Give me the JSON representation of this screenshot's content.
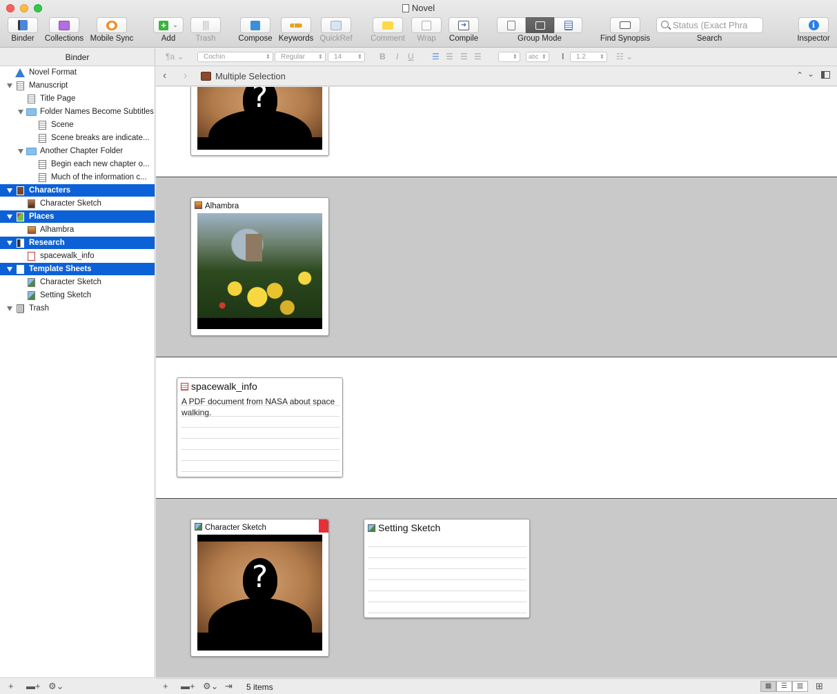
{
  "window": {
    "title": "Novel"
  },
  "toolbar": {
    "binder": "Binder",
    "collections": "Collections",
    "mobile_sync": "Mobile Sync",
    "add": "Add",
    "trash": "Trash",
    "compose": "Compose",
    "keywords": "Keywords",
    "quickref": "QuickRef",
    "comment": "Comment",
    "wrap": "Wrap",
    "compile": "Compile",
    "group_mode": "Group Mode",
    "find_synopsis": "Find Synopsis",
    "search_placeholder": "Status (Exact Phra",
    "search": "Search",
    "inspector": "Inspector"
  },
  "binder": {
    "header": "Binder",
    "items": [
      {
        "label": "Novel Format"
      },
      {
        "label": "Manuscript"
      },
      {
        "label": "Title Page"
      },
      {
        "label": "Folder Names Become Subtitles"
      },
      {
        "label": "Scene"
      },
      {
        "label": "Scene breaks are indicate..."
      },
      {
        "label": "Another Chapter Folder"
      },
      {
        "label": "Begin each new chapter o..."
      },
      {
        "label": "Much of the information c..."
      },
      {
        "label": "Characters"
      },
      {
        "label": "Character Sketch"
      },
      {
        "label": "Places"
      },
      {
        "label": "Alhambra"
      },
      {
        "label": "Research"
      },
      {
        "label": "spacewalk_info"
      },
      {
        "label": "Template Sheets"
      },
      {
        "label": "Character Sketch"
      },
      {
        "label": "Setting Sketch"
      },
      {
        "label": "Trash"
      }
    ]
  },
  "formatbar": {
    "style": "¶a",
    "font": "Cochin",
    "weight": "Regular",
    "size": "14",
    "bold": "B",
    "italic": "I",
    "underline": "U",
    "highlight": "abc",
    "line_spacing": "1.2"
  },
  "nav": {
    "title": "Multiple Selection"
  },
  "cards": {
    "alhambra": {
      "title": "Alhambra"
    },
    "spacewalk": {
      "title": "spacewalk_info",
      "synopsis": "A PDF document from NASA about space walking."
    },
    "character_sketch": {
      "title": "Character Sketch",
      "label_color": "#e5303a"
    },
    "setting_sketch": {
      "title": "Setting Sketch"
    },
    "question_mark": "?"
  },
  "status": {
    "item_count": "5 items"
  },
  "colors": {
    "selection": "#0d61d6",
    "band_gray": "#c9c9c9"
  }
}
